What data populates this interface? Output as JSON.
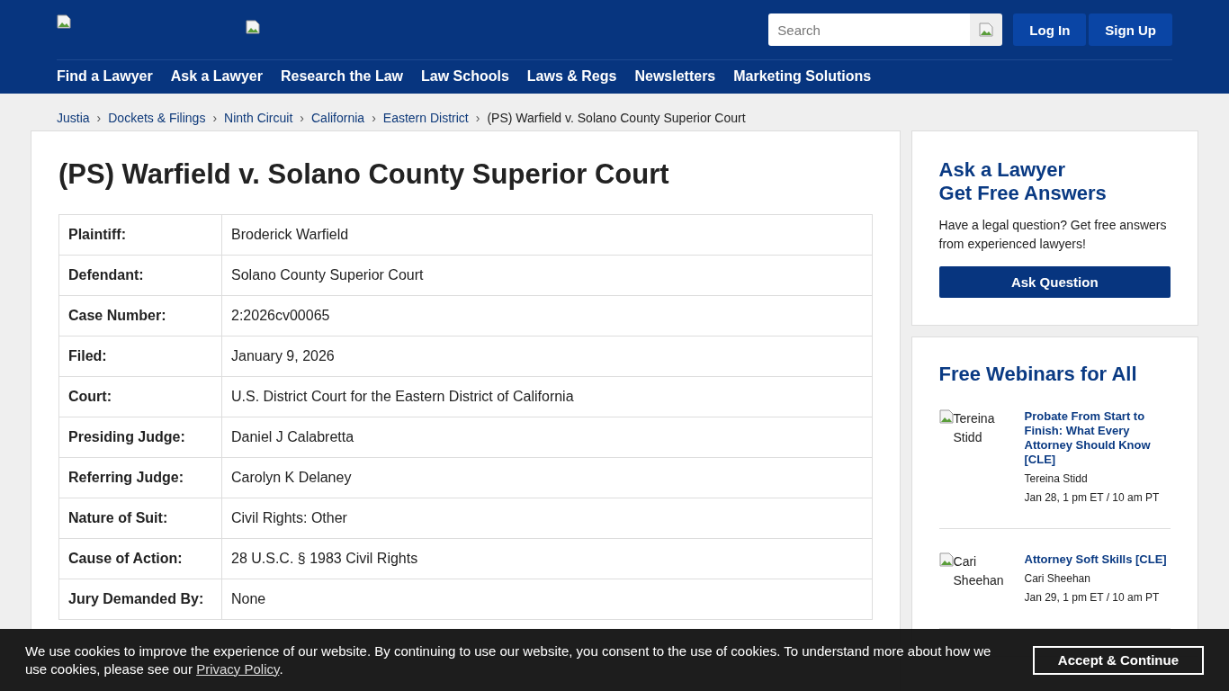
{
  "header": {
    "search": {
      "placeholder": "Search"
    },
    "buttons": [
      "Log In",
      "Sign Up"
    ],
    "nav": [
      "Find a Lawyer",
      "Ask a Lawyer",
      "Research the Law",
      "Law Schools",
      "Laws & Regs",
      "Newsletters",
      "Marketing Solutions"
    ]
  },
  "breadcrumb_separator": "›",
  "breadcrumbs": [
    "Justia",
    "Dockets & Filings",
    "Ninth Circuit",
    "California",
    "Eastern District",
    "(PS) Warfield v. Solano County Superior Court"
  ],
  "title": "(PS) Warfield v. Solano County Superior Court",
  "case_table": [
    {
      "label": "Plaintiff:",
      "value": "Broderick Warfield"
    },
    {
      "label": "Defendant:",
      "value": "Solano County Superior Court"
    },
    {
      "label": "Case Number:",
      "value": "2:2026cv00065"
    },
    {
      "label": "Filed:",
      "value": "January 9, 2026"
    },
    {
      "label": "Court:",
      "value": "U.S. District Court for the Eastern District of California"
    },
    {
      "label": "Presiding Judge:",
      "value": "Daniel J Calabretta"
    },
    {
      "label": "Referring Judge:",
      "value": "Carolyn K Delaney"
    },
    {
      "label": "Nature of Suit:",
      "value": "Civil Rights: Other"
    },
    {
      "label": "Cause of Action:",
      "value": "28 U.S.C. § 1983 Civil Rights"
    },
    {
      "label": "Jury Demanded By:",
      "value": "None"
    }
  ],
  "ask_card": {
    "title_lines": [
      "Ask a Lawyer",
      "Get Free Answers"
    ],
    "text": "Have a legal question? Get free answers from experienced lawyers!",
    "button": "Ask Question"
  },
  "webinars": {
    "title": "Free Webinars for All",
    "items": [
      {
        "photo_alt": "Tereina Stidd",
        "title": "Probate From Start to Finish: What Every Attorney Should Know [CLE]",
        "presenter": "Tereina Stidd",
        "time": "Jan 28, 1 pm ET / 10 am PT"
      },
      {
        "photo_alt": "Cari Sheehan",
        "title": "Attorney Soft Skills [CLE]",
        "presenter": "Cari Sheehan",
        "time": "Jan 29, 1 pm ET / 10 am PT"
      }
    ]
  },
  "cookie_banner": {
    "text_before": "We use cookies to improve the experience of our website. By continuing to use our website, you consent to the use of cookies. To understand more about how we use cookies, please see our",
    "link": "Privacy Policy",
    "text_after": ".",
    "button": "Accept & Continue"
  }
}
